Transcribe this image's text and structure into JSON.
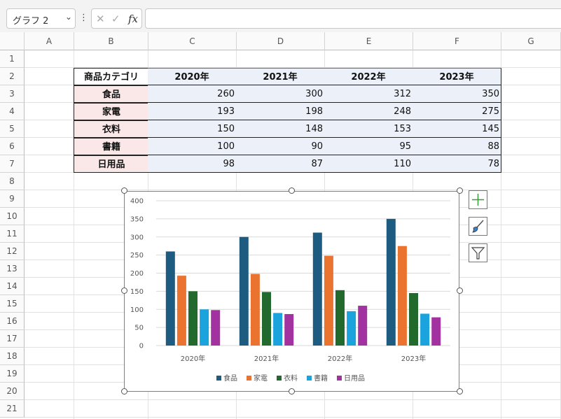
{
  "toolbar": {
    "name_box": "グラフ 2",
    "cancel_glyph": "✕",
    "enter_glyph": "✓",
    "fx_label": "fx",
    "formula_value": ""
  },
  "columns": [
    "A",
    "B",
    "C",
    "D",
    "E",
    "F",
    "G"
  ],
  "rows": [
    "1",
    "2",
    "3",
    "4",
    "5",
    "6",
    "7",
    "8",
    "9",
    "10",
    "11",
    "12",
    "13",
    "14",
    "15",
    "16",
    "17",
    "18",
    "19",
    "20",
    "21"
  ],
  "table": {
    "corner": "商品カテゴリ",
    "years": [
      "2020年",
      "2021年",
      "2022年",
      "2023年"
    ],
    "rows": [
      {
        "category": "食品",
        "values": [
          260,
          300,
          312,
          350
        ]
      },
      {
        "category": "家電",
        "values": [
          193,
          198,
          248,
          275
        ]
      },
      {
        "category": "衣料",
        "values": [
          150,
          148,
          153,
          145
        ]
      },
      {
        "category": "書籍",
        "values": [
          100,
          90,
          95,
          88
        ]
      },
      {
        "category": "日用品",
        "values": [
          98,
          87,
          110,
          78
        ]
      }
    ]
  },
  "colors": {
    "食品": "#1d5c80",
    "家電": "#eb7330",
    "衣料": "#21692c",
    "書籍": "#1aa3dd",
    "日用品": "#a2329f"
  },
  "chart_data": {
    "type": "bar",
    "categories": [
      "2020年",
      "2021年",
      "2022年",
      "2023年"
    ],
    "series": [
      {
        "name": "食品",
        "values": [
          260,
          300,
          312,
          350
        ]
      },
      {
        "name": "家電",
        "values": [
          193,
          198,
          248,
          275
        ]
      },
      {
        "name": "衣料",
        "values": [
          150,
          148,
          153,
          145
        ]
      },
      {
        "name": "書籍",
        "values": [
          100,
          90,
          95,
          88
        ]
      },
      {
        "name": "日用品",
        "values": [
          98,
          87,
          110,
          78
        ]
      }
    ],
    "ylim": [
      0,
      400
    ],
    "yticks": [
      0,
      50,
      100,
      150,
      200,
      250,
      300,
      350,
      400
    ],
    "grid": true,
    "legend": "bottom",
    "title": "",
    "xlabel": "",
    "ylabel": ""
  },
  "chart_tools": [
    "chart-elements-icon",
    "chart-styles-icon",
    "chart-filter-icon"
  ]
}
